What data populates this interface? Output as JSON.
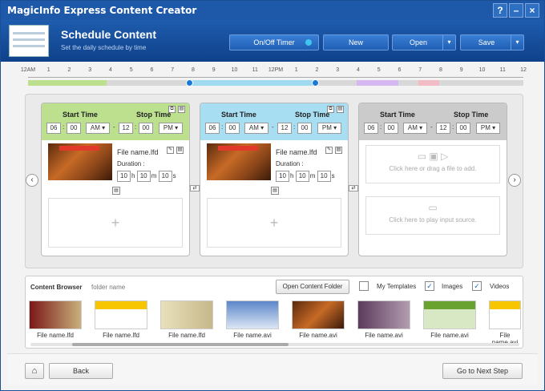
{
  "title": "MagicInfo Express Content Creator",
  "window_buttons": [
    "?",
    "–",
    "×"
  ],
  "header": {
    "title": "Schedule Content",
    "subtitle": "Set the daily schedule by time"
  },
  "toolbar": {
    "onoff": "On/Off Timer",
    "new": "New",
    "open": "Open",
    "save": "Save"
  },
  "timeline_ticks": [
    "12AM",
    "1",
    "2",
    "3",
    "4",
    "5",
    "6",
    "7",
    "8",
    "9",
    "10",
    "11",
    "12PM",
    "1",
    "2",
    "3",
    "4",
    "5",
    "6",
    "7",
    "8",
    "9",
    "10",
    "11",
    "12"
  ],
  "segments_colors": {
    "green": "#bde08e",
    "blue": "#9fdaf0",
    "purple": "#d4b8ef",
    "pink": "#f2bcc6"
  },
  "cards": [
    {
      "start_label": "Start Time",
      "stop_label": "Stop Time",
      "start_h": "06",
      "start_m": "00",
      "start_ap": "AM",
      "stop_h": "12",
      "stop_m": "00",
      "stop_ap": "PM",
      "file": "File name.lfd",
      "duration_label": "Duration :",
      "dh": "10",
      "dm": "10",
      "ds": "10",
      "h": "h",
      "m": "m",
      "s": "s",
      "dash": "-",
      "colon": ":"
    },
    {
      "start_label": "Start Time",
      "stop_label": "Stop Time",
      "start_h": "06",
      "start_m": "00",
      "start_ap": "AM",
      "stop_h": "12",
      "stop_m": "00",
      "stop_ap": "PM",
      "file": "File name.lfd",
      "duration_label": "Duration :",
      "dh": "10",
      "dm": "10",
      "ds": "10",
      "h": "h",
      "m": "m",
      "s": "s",
      "dash": "-",
      "colon": ":"
    },
    {
      "start_label": "Start Time",
      "stop_label": "Stop Time",
      "start_h": "06",
      "start_m": "00",
      "start_ap": "AM",
      "stop_h": "12",
      "stop_m": "00",
      "stop_ap": "PM",
      "add_file": "Click here or drag a file to add.",
      "input_source": "Click here to play input source.",
      "dash": "-",
      "colon": ":"
    }
  ],
  "browser": {
    "label": "Content Browser",
    "folder": "folder name",
    "open_folder": "Open Content Folder",
    "my_templates": "My Templates",
    "images": "Images",
    "videos": "Videos",
    "check": "✓",
    "items": [
      "File name.lfd",
      "File name.lfd",
      "File name.lfd",
      "File name.avi",
      "File name.avi",
      "File name.avi",
      "File name.avi",
      "File name.avi"
    ]
  },
  "footer": {
    "back": "Back",
    "next": "Go to Next Step"
  },
  "arrows": {
    "left": "‹",
    "right": "›",
    "down": "▾",
    "plus": "+"
  }
}
